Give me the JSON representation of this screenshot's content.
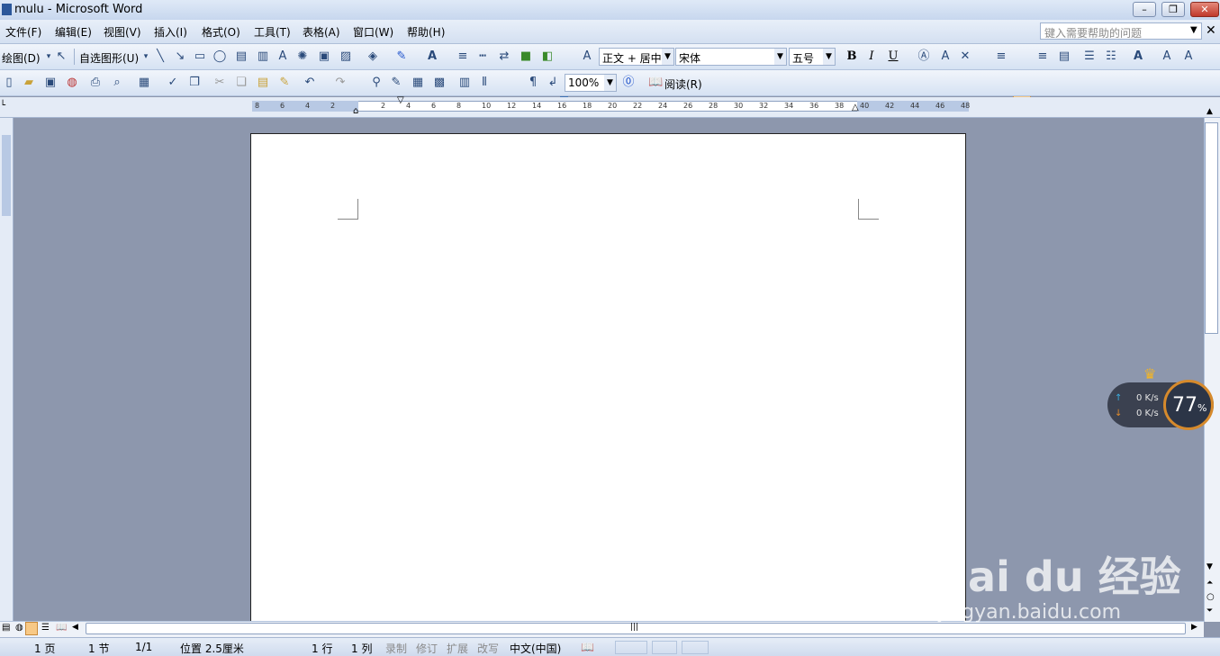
{
  "window": {
    "title": "mulu - Microsoft Word"
  },
  "menu": {
    "items": [
      "文件(F)",
      "编辑(E)",
      "视图(V)",
      "插入(I)",
      "格式(O)",
      "工具(T)",
      "表格(A)",
      "窗口(W)",
      "帮助(H)"
    ],
    "help_placeholder": "键入需要帮助的问题"
  },
  "drawing_toolbar": {
    "draw_label": "绘图(D)",
    "autoshapes_label": "自选图形(U)"
  },
  "formatting_toolbar": {
    "style": "正文 + 居中",
    "font": "宋体",
    "size": "五号",
    "bold": "B",
    "italic": "I",
    "underline": "U"
  },
  "standard_toolbar": {
    "zoom": "100%",
    "read_label": "阅读(R)"
  },
  "ruler": {
    "ticks": [
      "8",
      "6",
      "4",
      "2",
      "",
      "2",
      "4",
      "6",
      "8",
      "10",
      "12",
      "14",
      "16",
      "18",
      "20",
      "22",
      "24",
      "26",
      "28",
      "30",
      "32",
      "34",
      "36",
      "38",
      "40",
      "42",
      "44",
      "46",
      "48"
    ]
  },
  "status": {
    "page": "1 页",
    "section": "1 节",
    "pages": "1/1",
    "position": "位置 2.5厘米",
    "line": "1 行",
    "column": "1 列",
    "rec": "录制",
    "trk": "修订",
    "ext": "扩展",
    "ovr": "改写",
    "language": "中文(中国)"
  },
  "speed_widget": {
    "upload": "0 K/s",
    "download": "0 K/s",
    "percent": "77",
    "percent_unit": "%"
  },
  "watermark": {
    "line1": "Bai du 经验",
    "line2": "jingyan.baidu.com"
  },
  "colors": {
    "workspace": "#8d97ad",
    "toolbar": "#d6e2f3",
    "accent_pressed": "#f8c986"
  }
}
